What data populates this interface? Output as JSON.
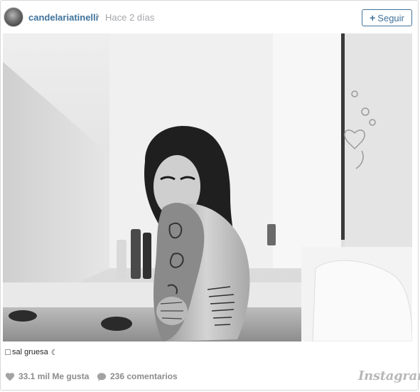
{
  "post": {
    "username": "candelariatinelli",
    "separator": "•",
    "time": "Hace 2 días",
    "follow_label": "Seguir",
    "follow_plus": "+"
  },
  "caption": {
    "text": "sal gruesa",
    "emoji": "☾"
  },
  "stats": {
    "likes": "33.1 mil Me gusta",
    "comments": "236 comentarios"
  },
  "brand": {
    "name": "Instagram"
  },
  "colors": {
    "link": "#3f729b",
    "muted": "#a5a7aa",
    "stats": "#8c8c8c"
  },
  "icons": [
    "heart-icon",
    "comment-icon",
    "checkbox-icon",
    "moon-icon"
  ]
}
